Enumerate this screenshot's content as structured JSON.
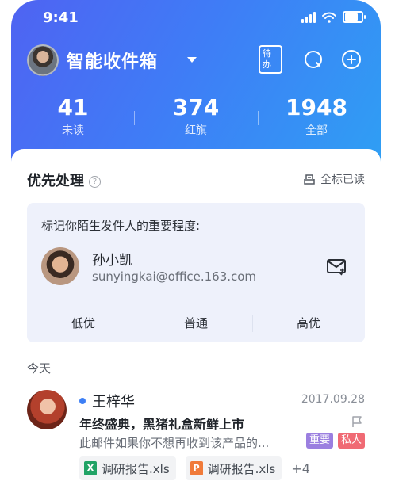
{
  "status_bar": {
    "time": "9:41"
  },
  "header": {
    "title": "智能收件箱",
    "todo_label": "待办",
    "icons": [
      "search-icon",
      "plus-circle-icon",
      "chevron-down-icon"
    ]
  },
  "stats": [
    {
      "value": "41",
      "label": "未读"
    },
    {
      "value": "374",
      "label": "红旗"
    },
    {
      "value": "1948",
      "label": "全部"
    }
  ],
  "priority_section": {
    "title": "优先处理",
    "help_glyph": "?",
    "mark_all_label": "全标已读",
    "prompt": "标记你陌生发件人的重要程度:",
    "sender": {
      "name": "孙小凯",
      "email": "sunyingkai@office.163.com"
    },
    "options": [
      "低优",
      "普通",
      "高优"
    ]
  },
  "today_label": "今天",
  "mail": {
    "sender": "王梓华",
    "date": "2017.09.28",
    "subject": "年终盛典，黑猪礼盒新鲜上市",
    "preview": "此邮件如果你不想再收到该产品的...",
    "tags": [
      {
        "label": "重要",
        "color": "#9b7fe0"
      },
      {
        "label": "私人",
        "color": "#f06a74"
      }
    ],
    "attachments": [
      {
        "name": "调研报告.xls",
        "type": "X",
        "color": "#21a366"
      },
      {
        "name": "调研报告.xls",
        "type": "P",
        "color": "#f07a3a"
      }
    ],
    "more": "+4"
  },
  "colors": {
    "accent": "#3d7ff5",
    "hero_start": "#4f63f2",
    "hero_end": "#2f9ff4"
  }
}
